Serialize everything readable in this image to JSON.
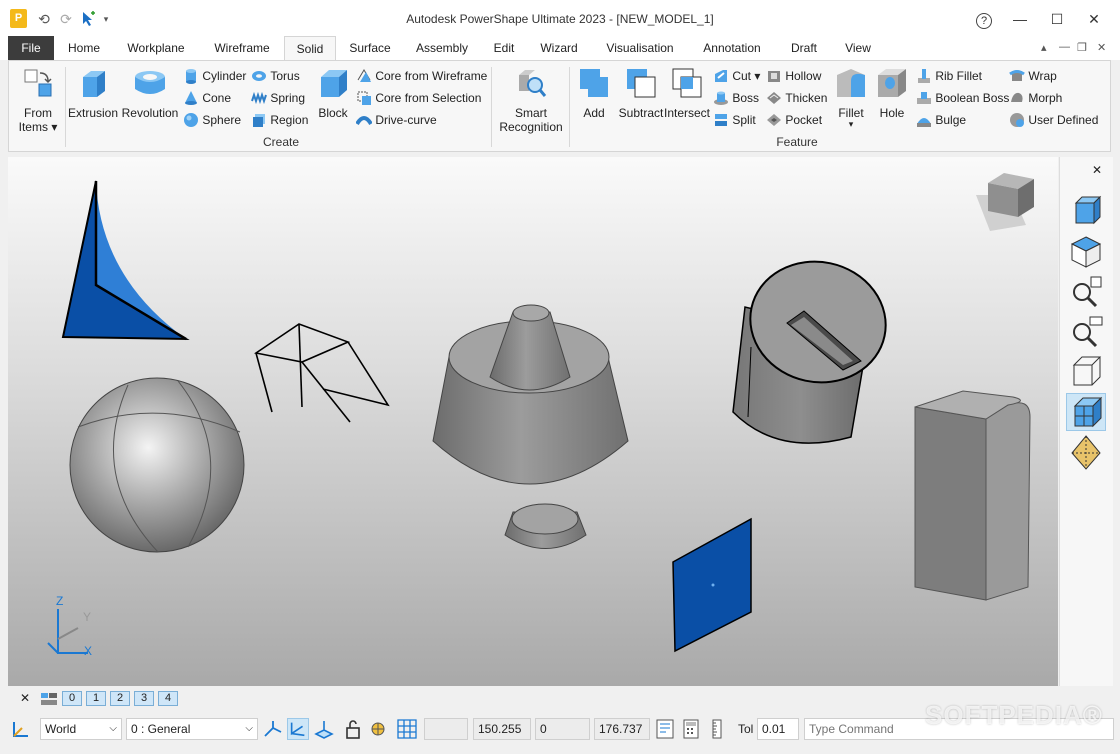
{
  "window": {
    "title": "Autodesk PowerShape Ultimate 2023 - [NEW_MODEL_1]",
    "logo": "P",
    "help": "?",
    "minimize": "—",
    "maximize": "☐",
    "close": "✕"
  },
  "tabs": {
    "file": "File",
    "items": [
      "Home",
      "Workplane",
      "Wireframe",
      "Solid",
      "Surface",
      "Assembly",
      "Edit",
      "Wizard",
      "Visualisation",
      "Annotation",
      "Draft",
      "View"
    ],
    "active": "Solid"
  },
  "ribbon": {
    "create": {
      "group_label": "Create",
      "from_items_1": "From",
      "from_items_2": "Items",
      "extrusion": "Extrusion",
      "revolution": "Revolution",
      "cylinder": "Cylinder",
      "cone": "Cone",
      "sphere": "Sphere",
      "torus": "Torus",
      "spring": "Spring",
      "region": "Region",
      "block": "Block",
      "core_from_wireframe": "Core from Wireframe",
      "core_from_selection": "Core from Selection",
      "drive_curve": "Drive-curve"
    },
    "feature": {
      "group_label": "Feature",
      "smart_recognition_1": "Smart",
      "smart_recognition_2": "Recognition",
      "add": "Add",
      "subtract": "Subtract",
      "intersect": "Intersect",
      "cut": "Cut",
      "boss": "Boss",
      "split": "Split",
      "hollow": "Hollow",
      "thicken": "Thicken",
      "pocket": "Pocket",
      "fillet": "Fillet",
      "hole": "Hole",
      "rib_fillet": "Rib Fillet",
      "boolean_boss": "Boolean Boss",
      "bulge": "Bulge",
      "wrap": "Wrap",
      "morph": "Morph",
      "user_defined": "User Defined"
    }
  },
  "viewport": {
    "axis_labels": {
      "z": "Z",
      "y": "Y",
      "x": "X"
    }
  },
  "levels": {
    "close": "✕",
    "buttons": [
      "0",
      "1",
      "2",
      "3",
      "4"
    ]
  },
  "status": {
    "workplane": "World",
    "level": "0  : General",
    "x": "150.255",
    "y": "0",
    "z": "176.737",
    "tol_label": "Tol",
    "tol_value": "0.01",
    "command_placeholder": "Type Command"
  },
  "watermark": "SOFTPEDIA®",
  "colors": {
    "accent": "#4ea3e8",
    "solid_blue": "#0a4fa6",
    "solid_gray": "#8c8c8c"
  }
}
